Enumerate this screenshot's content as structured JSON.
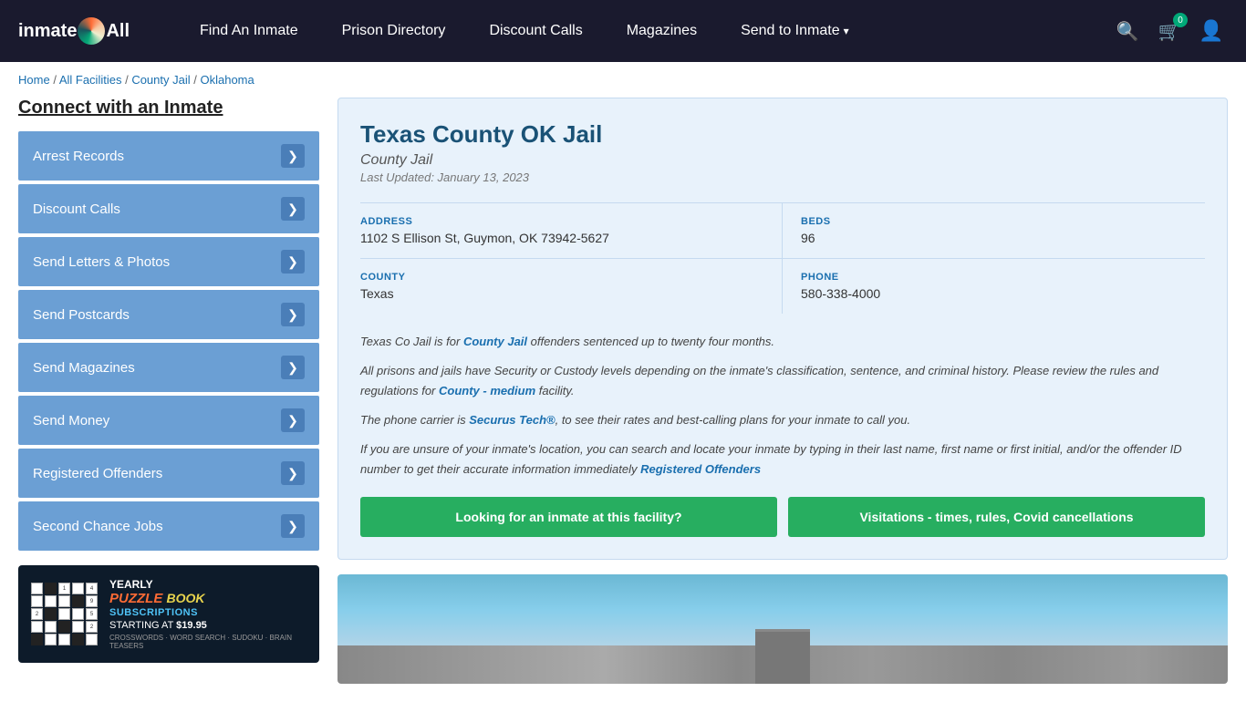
{
  "header": {
    "logo_text_1": "inmate",
    "logo_text_2": "All",
    "nav": [
      {
        "label": "Find An Inmate",
        "id": "find-inmate",
        "dropdown": false
      },
      {
        "label": "Prison Directory",
        "id": "prison-directory",
        "dropdown": false
      },
      {
        "label": "Discount Calls",
        "id": "discount-calls",
        "dropdown": false
      },
      {
        "label": "Magazines",
        "id": "magazines",
        "dropdown": false
      },
      {
        "label": "Send to Inmate",
        "id": "send-to-inmate",
        "dropdown": true
      }
    ],
    "cart_count": "0"
  },
  "breadcrumb": {
    "items": [
      {
        "label": "Home",
        "href": "#"
      },
      {
        "label": "All Facilities",
        "href": "#"
      },
      {
        "label": "County Jail",
        "href": "#"
      },
      {
        "label": "Oklahoma",
        "href": "#"
      }
    ]
  },
  "sidebar": {
    "title": "Connect with an Inmate",
    "items": [
      {
        "label": "Arrest Records",
        "id": "arrest-records"
      },
      {
        "label": "Discount Calls",
        "id": "discount-calls"
      },
      {
        "label": "Send Letters & Photos",
        "id": "send-letters"
      },
      {
        "label": "Send Postcards",
        "id": "send-postcards"
      },
      {
        "label": "Send Magazines",
        "id": "send-magazines"
      },
      {
        "label": "Send Money",
        "id": "send-money"
      },
      {
        "label": "Registered Offenders",
        "id": "registered-offenders"
      },
      {
        "label": "Second Chance Jobs",
        "id": "second-chance-jobs"
      }
    ],
    "ad": {
      "title_yearly": "YEARLY",
      "title_puzzle": "PUZZLE BOOK",
      "title_subs": "SUBSCRIPTIONS",
      "title_starting": "STARTING AT",
      "price": "$19.95",
      "types": "CROSSWORDS · WORD SEARCH · SUDOKU · BRAIN TEASERS"
    }
  },
  "facility": {
    "name": "Texas County OK Jail",
    "type": "County Jail",
    "last_updated": "Last Updated: January 13, 2023",
    "address_label": "ADDRESS",
    "address_value": "1102 S Ellison St, Guymon, OK 73942-5627",
    "beds_label": "BEDS",
    "beds_value": "96",
    "county_label": "COUNTY",
    "county_value": "Texas",
    "phone_label": "PHONE",
    "phone_value": "580-338-4000",
    "desc1": "Texas Co Jail is for ",
    "desc1_link": "County Jail",
    "desc1_rest": " offenders sentenced up to twenty four months.",
    "desc2": "All prisons and jails have Security or Custody levels depending on the inmate's classification, sentence, and criminal history. Please review the rules and regulations for ",
    "desc2_link": "County - medium",
    "desc2_rest": " facility.",
    "desc3": "The phone carrier is ",
    "desc3_link": "Securus Tech®",
    "desc3_rest": ", to see their rates and best-calling plans for your inmate to call you.",
    "desc4": "If you are unsure of your inmate's location, you can search and locate your inmate by typing in their last name, first name or first initial, and/or the offender ID number to get their accurate information immediately ",
    "desc4_link": "Registered Offenders",
    "btn_find": "Looking for an inmate at this facility?",
    "btn_visitations": "Visitations - times, rules, Covid cancellations"
  }
}
